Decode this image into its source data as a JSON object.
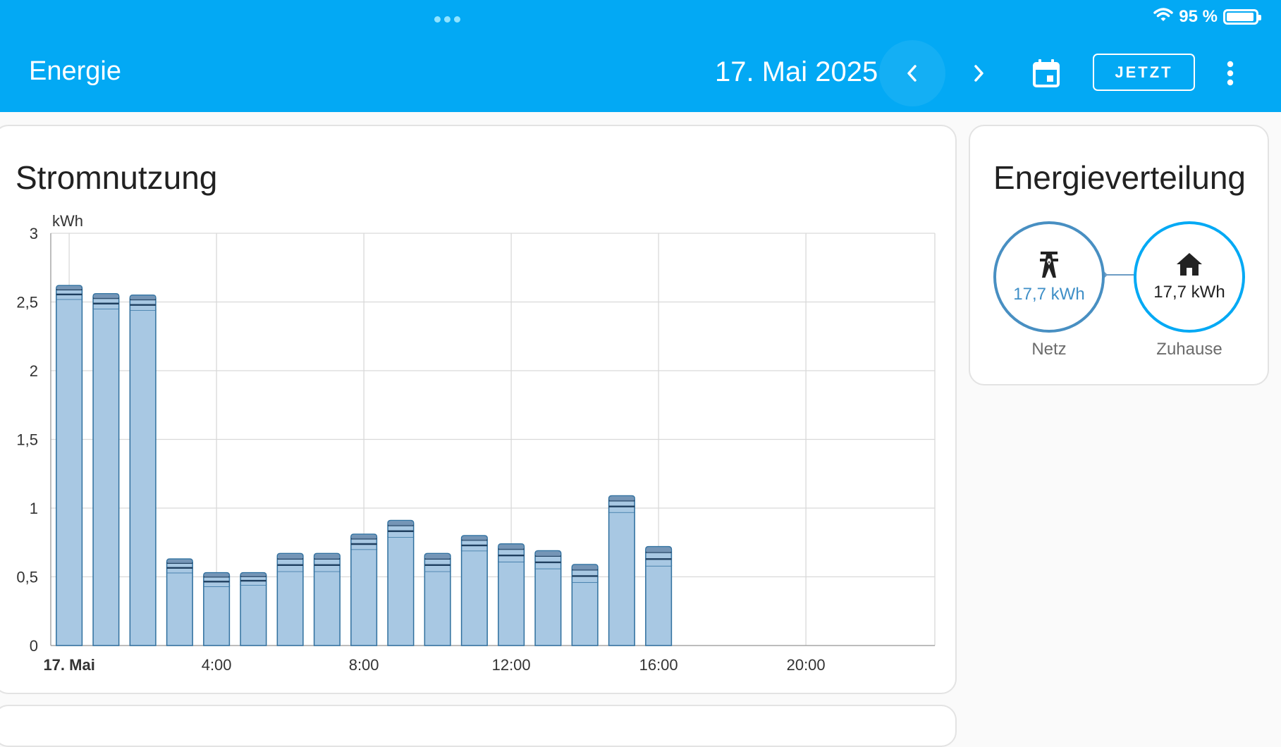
{
  "status_bar": {
    "battery": "95 %",
    "battery_level": 0.95
  },
  "header": {
    "title": "Energie",
    "date": "17. Mai 2025",
    "now_button": "JETZT"
  },
  "usage_card": {
    "title": "Stromnutzung"
  },
  "distribution_card": {
    "title": "Energieverteilung",
    "grid": {
      "label": "Netz",
      "value": "17,7 kWh"
    },
    "home": {
      "label": "Zuhause",
      "value": "17,7 kWh"
    }
  },
  "icons": {
    "wifi": "wifi-icon",
    "battery": "battery-icon",
    "prev": "chevron-left-icon",
    "next": "chevron-right-icon",
    "calendar": "calendar-icon",
    "more": "more-vert-icon",
    "grid": "transmission-tower-icon",
    "home": "home-icon"
  },
  "colors": {
    "primary": "#03a9f4",
    "grid_circle": "#488fc2",
    "home_circle": "#03a9f4",
    "bar_fill": "#a8c8e3",
    "bar_stroke": "#2f6f9e",
    "bar_top": "#6f8fb0"
  },
  "chart_data": {
    "type": "bar",
    "stacked": true,
    "unit": "kWh",
    "x_tick_labels": [
      "17. Mai",
      "4:00",
      "8:00",
      "12:00",
      "16:00",
      "20:00"
    ],
    "x_tick_hours": [
      0,
      4,
      8,
      12,
      16,
      20
    ],
    "hours": [
      0,
      1,
      2,
      3,
      4,
      5,
      6,
      7,
      8,
      9,
      10,
      11,
      12,
      13,
      14,
      15,
      16
    ],
    "totals": [
      2.62,
      2.56,
      2.55,
      0.63,
      0.53,
      0.53,
      0.67,
      0.67,
      0.81,
      0.91,
      0.67,
      0.8,
      0.74,
      0.69,
      0.59,
      1.09,
      0.72
    ],
    "main_values": [
      2.52,
      2.45,
      2.44,
      0.53,
      0.43,
      0.44,
      0.54,
      0.54,
      0.7,
      0.79,
      0.54,
      0.69,
      0.61,
      0.56,
      0.46,
      0.97,
      0.58
    ],
    "y_tick_labels": [
      "0",
      "0,5",
      "1",
      "1,5",
      "2",
      "2,5",
      "3"
    ],
    "ylim": [
      0,
      3
    ],
    "xlim_hours": [
      0,
      24
    ],
    "grid": true
  }
}
